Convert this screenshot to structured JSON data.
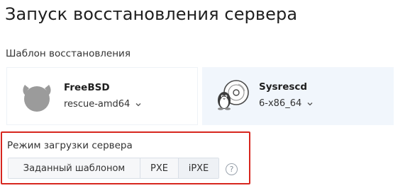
{
  "page": {
    "title": "Запуск восстановления сервера"
  },
  "templates": {
    "label": "Шаблон восстановления",
    "items": [
      {
        "name": "FreeBSD",
        "variant": "rescue-amd64",
        "icon": "freebsd-daemon-icon"
      },
      {
        "name": "Sysrescd",
        "variant": "6-x86_64",
        "icon": "sysrescd-penguin-cd-icon",
        "selected": true
      }
    ]
  },
  "boot_mode": {
    "label": "Режим загрузки сервера",
    "options": [
      "Заданный шаблоном",
      "PXE",
      "iPXE"
    ],
    "selected": "iPXE",
    "help_glyph": "?",
    "highlight_color": "#d7261e"
  },
  "colors": {
    "selected_card_bg": "#f1f6fc",
    "highlight_border": "#d7261e"
  }
}
